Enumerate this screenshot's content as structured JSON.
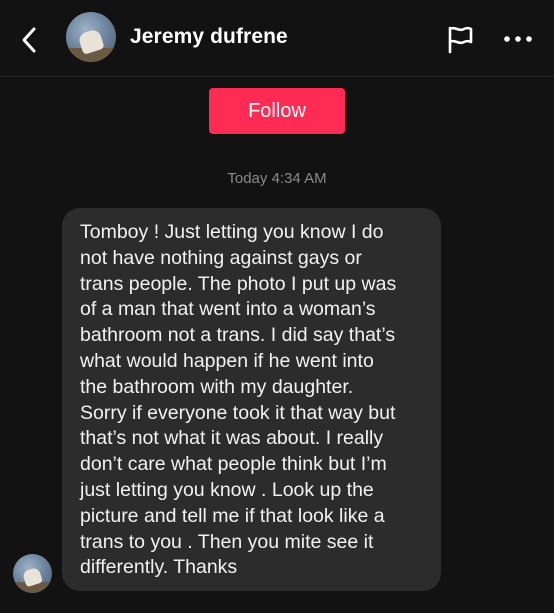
{
  "header": {
    "back_icon": "chevron-left-icon",
    "contact_name": "Jeremy dufrene",
    "report_icon": "flag-icon",
    "more_icon": "more-horizontal-icon"
  },
  "follow_label": "Follow",
  "colors": {
    "background": "#121212",
    "follow_button": "#fe2c55",
    "bubble": "#2c2c2c",
    "timestamp": "#8a8a8a"
  },
  "conversation": {
    "timestamp": "Today 4:34 AM",
    "messages": [
      {
        "text": "Tomboy ! Just letting you know I do\nnot have nothing against gays or\ntrans people. The photo I put up was\nof a man that went into a woman’s\nbathroom not a trans. I did say that’s\nwhat would happen if he went into\nthe bathroom with my daughter.\nSorry if everyone took it that way but\nthat’s not what it was about. I really\ndon’t care what people think but I’m\njust letting you know . Look up the\npicture and tell me if that look like a\ntrans to you . Then you mite see it\ndifferently. Thanks"
      }
    ]
  }
}
